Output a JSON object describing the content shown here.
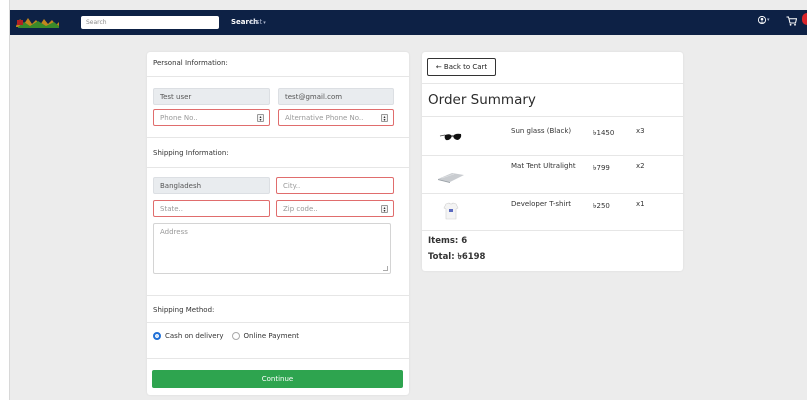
{
  "navbar": {
    "search_placeholder": "Search",
    "search_label": "Search",
    "list_label": "List",
    "colors": {
      "background": "#0d2145",
      "badge": "#d9242a"
    }
  },
  "form": {
    "personal_title": "Personal Information:",
    "name_value": "Test user",
    "email_value": "test@gmail.com",
    "phone_placeholder": "Phone No..",
    "alt_phone_placeholder": "Alternative Phone No..",
    "shipping_title": "Shipping Information:",
    "country_value": "Bangladesh",
    "city_placeholder": "City..",
    "state_placeholder": "State..",
    "zip_placeholder": "Zip code..",
    "address_placeholder": "Address",
    "method_title": "Shipping Method:",
    "methods": [
      {
        "label": "Cash on delivery",
        "selected": true
      },
      {
        "label": "Online Payment",
        "selected": false
      }
    ],
    "continue_label": "Continue",
    "colors": {
      "invalid_border": "#e06d6d",
      "continue": "#2ea44f",
      "radio": "#1f6fd6"
    }
  },
  "summary": {
    "back_label": "← Back to Cart",
    "title": "Order Summary",
    "items": [
      {
        "name": "Sun glass (Black)",
        "price": "৳1450",
        "qty": "x3",
        "icon": "sunglasses-icon"
      },
      {
        "name": "Mat Tent Ultralight",
        "price": "৳799",
        "qty": "x2",
        "icon": "tent-mat-icon"
      },
      {
        "name": "Developer T-shirt",
        "price": "৳250",
        "qty": "x1",
        "icon": "tshirt-icon"
      }
    ],
    "items_total": "Items: 6",
    "price_total": "Total: ৳6198"
  }
}
